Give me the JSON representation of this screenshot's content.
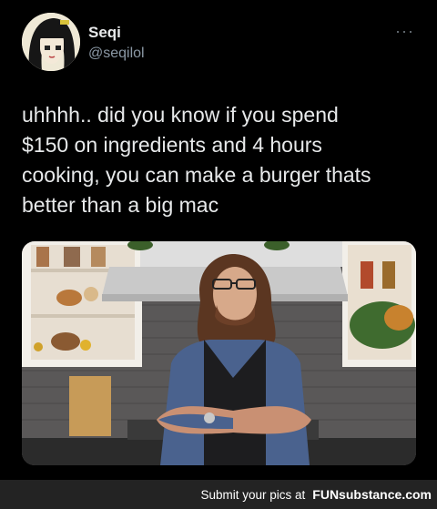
{
  "tweet": {
    "display_name": "Seqi",
    "handle": "@seqilol",
    "more_label": "···",
    "text": "uhhhh.. did you know if you spend\n$150 on ingredients and 4 hours\ncooking, you can make a burger thats\nbetter than a big mac",
    "media_icon": "chef-in-kitchen-photo"
  },
  "footer": {
    "cta": "Submit your pics at",
    "brand": "FUNsubstance",
    "domain": ".com"
  },
  "colors": {
    "background": "#000000",
    "text": "#e7e9ea",
    "muted": "#8b98a5",
    "footer_bg": "#232323"
  }
}
